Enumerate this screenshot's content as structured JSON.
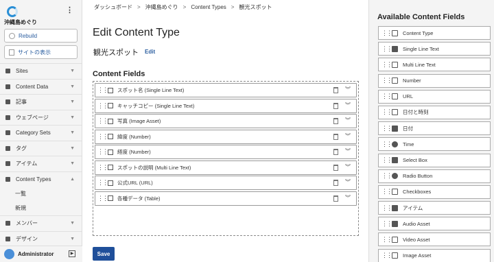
{
  "sidebar": {
    "site_name": "沖縄島めぐり",
    "rebuild_label": "Rebuild",
    "view_site_label": "サイトの表示",
    "nav": [
      {
        "label": "Sites"
      },
      {
        "label": "Content Data"
      },
      {
        "label": "記事"
      },
      {
        "label": "ウェブページ"
      },
      {
        "label": "Category Sets"
      },
      {
        "label": "タグ"
      },
      {
        "label": "アイテム"
      },
      {
        "label": "Content Types"
      }
    ],
    "sub": [
      {
        "label": "一覧"
      },
      {
        "label": "新規"
      }
    ],
    "nav2": [
      {
        "label": "メンバー"
      },
      {
        "label": "デザイン"
      }
    ],
    "user": "Administrator"
  },
  "breadcrumb": [
    "ダッシュボード",
    "沖縄島めぐり",
    "Content Types",
    "観光スポット"
  ],
  "page_title": "Edit Content Type",
  "content_type_name": "観光スポット",
  "edit_label": "Edit",
  "section_title": "Content Fields",
  "fields": [
    {
      "label": "スポット名 (Single Line Text)"
    },
    {
      "label": "キャッチコピー (Single Line Text)"
    },
    {
      "label": "写真 (Image Asset)"
    },
    {
      "label": "緯度 (Number)"
    },
    {
      "label": "経度 (Number)"
    },
    {
      "label": "スポットの説明 (Multi Line Text)"
    },
    {
      "label": "公式URL (URL)"
    },
    {
      "label": "各種データ (Table)"
    }
  ],
  "save_label": "Save",
  "available_title": "Available Content Fields",
  "available": [
    {
      "label": "Content Type",
      "icon": "content-type-icon"
    },
    {
      "label": "Single Line Text",
      "icon": "single-line-text-icon"
    },
    {
      "label": "Multi Line Text",
      "icon": "multi-line-text-icon"
    },
    {
      "label": "Number",
      "icon": "number-icon"
    },
    {
      "label": "URL",
      "icon": "url-icon"
    },
    {
      "label": "日付と時刻",
      "icon": "datetime-icon"
    },
    {
      "label": "日付",
      "icon": "date-icon"
    },
    {
      "label": "Time",
      "icon": "clock-icon"
    },
    {
      "label": "Select Box",
      "icon": "select-box-icon"
    },
    {
      "label": "Radio Button",
      "icon": "radio-icon"
    },
    {
      "label": "Checkboxes",
      "icon": "checkbox-icon"
    },
    {
      "label": "アイテム",
      "icon": "folder-icon"
    },
    {
      "label": "Audio Asset",
      "icon": "audio-icon"
    },
    {
      "label": "Video Asset",
      "icon": "video-icon"
    },
    {
      "label": "Image Asset",
      "icon": "image-icon"
    }
  ]
}
